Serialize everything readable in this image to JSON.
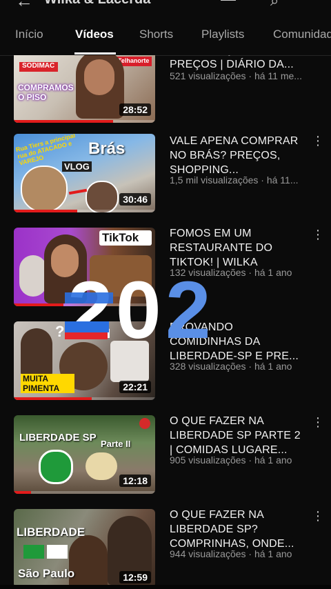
{
  "topbar": {
    "title": "Wilka & Lacerda",
    "back_glyph": "←",
    "search_glyph": "⌕"
  },
  "tabs": [
    "Início",
    "Vídeos",
    "Shorts",
    "Playlists",
    "Comunidade"
  ],
  "videos": [
    {
      "title": "CONSTRUÇÃO + PREÇOS | DIÁRIO DA...",
      "meta": "521 visualizações · há 11 me...",
      "duration": "28:52",
      "thumb_labels": [
        "SODIMAC",
        "Telhanorte",
        "COMPRAMOS O PISO"
      ]
    },
    {
      "title": "VALE APENA COMPRAR NO BRÁS? PREÇOS, SHOPPING...",
      "meta": "1,5 mil visualizações · há 11...",
      "duration": "30:46",
      "thumb_labels": [
        "Brás",
        "VLOG",
        "Rua Tiers a principal rua do ATACADO e VAREJO"
      ]
    },
    {
      "title": "FOMOS EM UM RESTAURANTE DO TIKTOK! | WILKA",
      "meta": "132 visualizações · há 1 ano",
      "duration": "",
      "thumb_labels": [
        "TikTok"
      ]
    },
    {
      "title": "PROVANDO COMIDINHAS DA LIBERDADE-SP E PRE...",
      "meta": "328 visualizações · há 1 ano",
      "duration": "22:21",
      "thumb_labels": [
        "MUITA PIMENTA",
        "??"
      ]
    },
    {
      "title": "O QUE FAZER NA LIBERDADE SP PARTE 2 | COMIDAS LUGARE...",
      "meta": "905 visualizações · há 1 ano",
      "duration": "12:18",
      "thumb_labels": [
        "LIBERDADE SP",
        "Parte II"
      ]
    },
    {
      "title": "O QUE FAZER NA LIBERDADE SP? COMPRINHAS, ONDE...",
      "meta": "944 visualizações · há 1 ano",
      "duration": "12:59",
      "thumb_labels": [
        "LIBERDADE",
        "São Paulo"
      ]
    }
  ],
  "overlay": {
    "text": "202",
    "colors": [
      "#2a6fe0",
      "#ffffff",
      "#e5262a"
    ]
  }
}
